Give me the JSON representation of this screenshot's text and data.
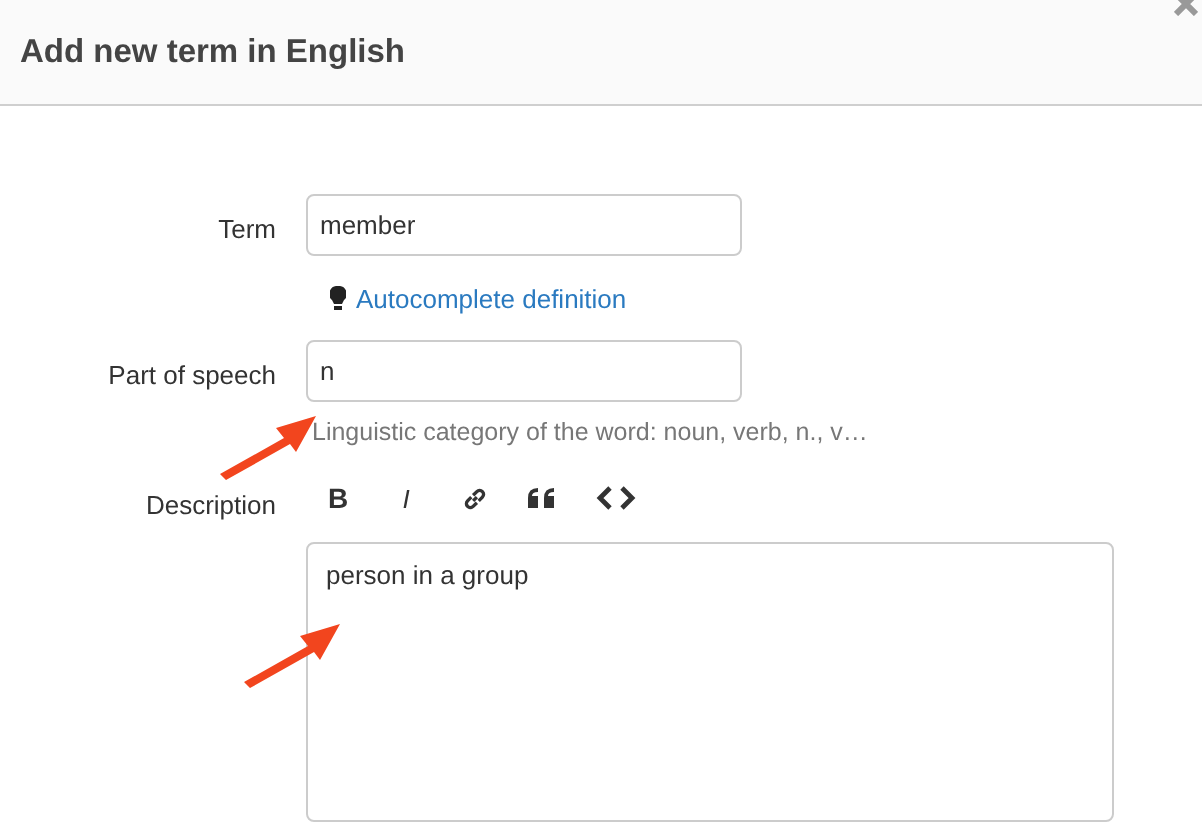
{
  "dialog": {
    "title": "Add new term in English"
  },
  "fields": [
    {
      "kind": "input",
      "label": "Term",
      "value": "member",
      "action": {
        "label": "Autocomplete definition"
      }
    },
    {
      "kind": "input",
      "label": "Part of speech",
      "value": "n",
      "hint": "Linguistic category of the word: noun, verb, n., v…"
    },
    {
      "kind": "editor",
      "label": "Description",
      "value": "person in a group",
      "toolbar": [
        {
          "kind": "bold",
          "label": "B"
        },
        {
          "kind": "italic",
          "label": "I"
        },
        {
          "kind": "link"
        },
        {
          "kind": "quote"
        },
        {
          "kind": "code"
        }
      ]
    }
  ]
}
